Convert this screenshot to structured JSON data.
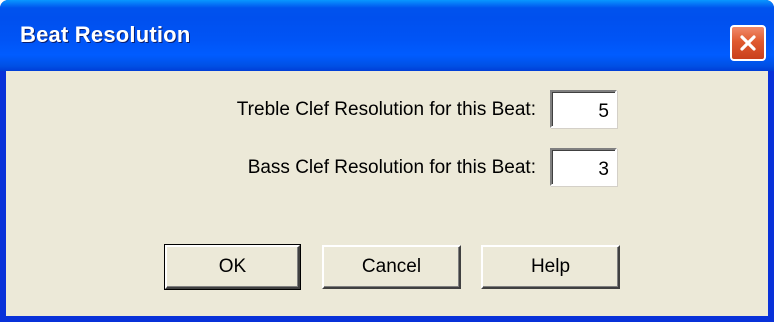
{
  "window": {
    "title": "Beat Resolution",
    "close_icon": "close-icon",
    "accent_color": "#0054e3",
    "close_color": "#e05a2f"
  },
  "form": {
    "treble": {
      "label": "Treble Clef Resolution for this Beat:",
      "value": "5"
    },
    "bass": {
      "label": "Bass Clef Resolution for this Beat:",
      "value": "3"
    }
  },
  "buttons": {
    "ok": "OK",
    "cancel": "Cancel",
    "help": "Help"
  }
}
